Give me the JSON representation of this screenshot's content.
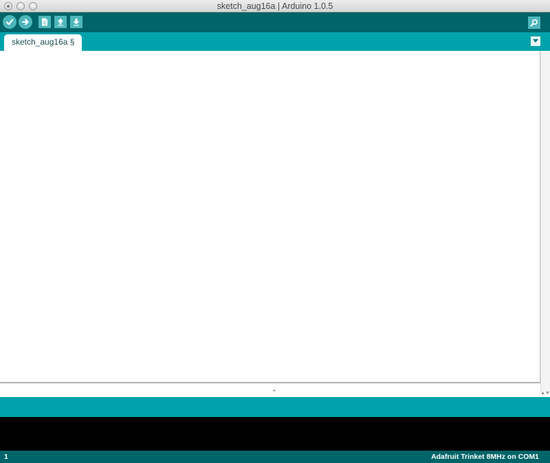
{
  "window": {
    "title": "sketch_aug16a | Arduino 1.0.5"
  },
  "toolbar": {
    "buttons": [
      {
        "name": "verify",
        "icon": "check-icon"
      },
      {
        "name": "upload",
        "icon": "arrow-right-icon"
      },
      {
        "name": "new",
        "icon": "document-icon"
      },
      {
        "name": "open",
        "icon": "arrow-up-icon"
      },
      {
        "name": "save",
        "icon": "arrow-down-icon"
      },
      {
        "name": "serial-monitor",
        "icon": "magnifier-icon"
      }
    ]
  },
  "tabs": [
    {
      "label": "sketch_aug16a §",
      "active": true
    }
  ],
  "editor": {
    "content": ""
  },
  "console": {
    "content": ""
  },
  "status": {
    "line": "1",
    "board": "Adafruit Trinket 8MHz on COM1"
  },
  "colors": {
    "toolbar": "#006468",
    "tabs_bar": "#00a3ac",
    "button": "#4db7bb",
    "console": "#000000"
  }
}
